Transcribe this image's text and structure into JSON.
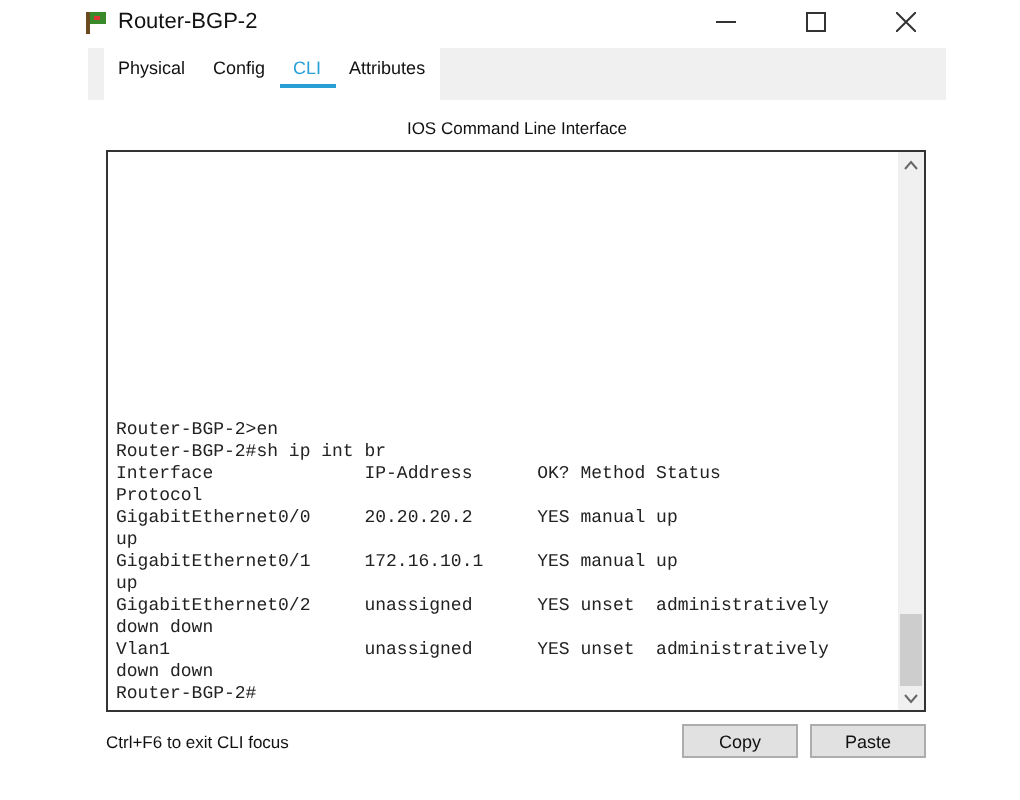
{
  "window": {
    "title": "Router-BGP-2"
  },
  "tabs": [
    {
      "label": "Physical",
      "selected": false
    },
    {
      "label": "Config",
      "selected": false
    },
    {
      "label": "CLI",
      "selected": true
    },
    {
      "label": "Attributes",
      "selected": false
    }
  ],
  "cli": {
    "heading": "IOS Command Line Interface",
    "lines": [
      "Router-BGP-2>en",
      "Router-BGP-2#sh ip int br",
      "Interface              IP-Address      OK? Method Status",
      "Protocol",
      "GigabitEthernet0/0     20.20.20.2      YES manual up",
      "up",
      "GigabitEthernet0/1     172.16.10.1     YES manual up",
      "up",
      "GigabitEthernet0/2     unassigned      YES unset  administratively",
      "down down",
      "Vlan1                  unassigned      YES unset  administratively",
      "down down",
      "Router-BGP-2#"
    ]
  },
  "footer": {
    "hint": "Ctrl+F6 to exit CLI focus",
    "buttons": [
      "Copy",
      "Paste"
    ]
  }
}
